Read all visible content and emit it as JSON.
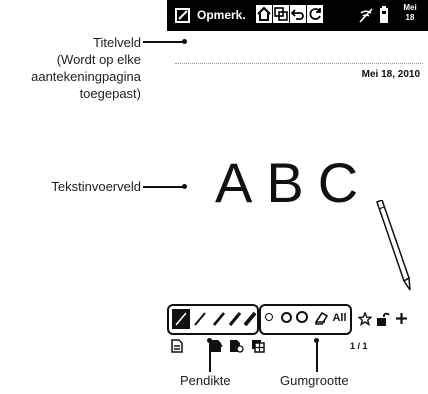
{
  "topbar": {
    "app_title": "Opmerk.",
    "date_badge_line1": "Mei",
    "date_badge_line2": "18"
  },
  "note": {
    "date": "Mei 18, 2010",
    "letters": "ABC"
  },
  "callouts": {
    "title_field_l1": "Titelveld",
    "title_field_l2": "(Wordt op elke",
    "title_field_l3": "aantekeningpagina",
    "title_field_l4": "toegepast)",
    "text_field": "Tekstinvoerveld",
    "pen_thickness": "Pendikte",
    "eraser_size": "Gumgrootte"
  },
  "toolbar": {
    "eraser_all_label": "All",
    "page_indicator": "1 / 1"
  }
}
